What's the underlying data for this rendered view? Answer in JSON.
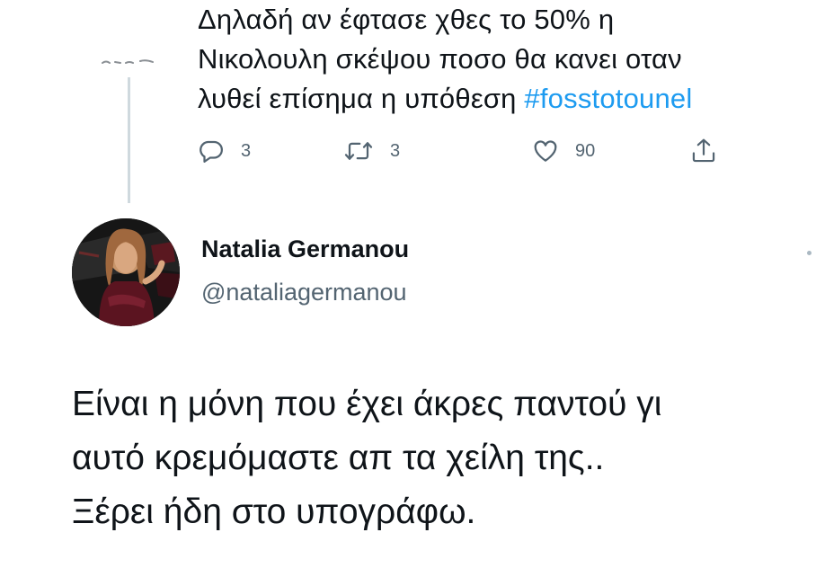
{
  "parent_tweet": {
    "text_lines": [
      "Δηλαδή αν έφτασε χθες το 50% η",
      "Νικολουλη σκέψου ποσο θα κανει οταν",
      "λυθεί επίσημα η υπόθεση "
    ],
    "hashtag": "#fosstotounel",
    "replies": "3",
    "retweets": "3",
    "likes": "90"
  },
  "tweet": {
    "author_name": "Natalia Germanou",
    "author_handle": "@nataliagermanou",
    "text_lines": [
      "Είναι η μόνη που έχει άκρες παντού γι",
      "αυτό κρεμόμαστε απ τα χείλη της..",
      "Ξέρει ήδη στο υπογράφω."
    ]
  },
  "icons": {
    "reply": "reply-icon",
    "retweet": "retweet-icon",
    "like": "heart-icon",
    "share": "share-icon",
    "more": "more-icon"
  },
  "colors": {
    "text": "#0f1419",
    "secondary": "#536471",
    "hashtag": "#1d9bf0",
    "thread_line": "#cfd9de"
  }
}
